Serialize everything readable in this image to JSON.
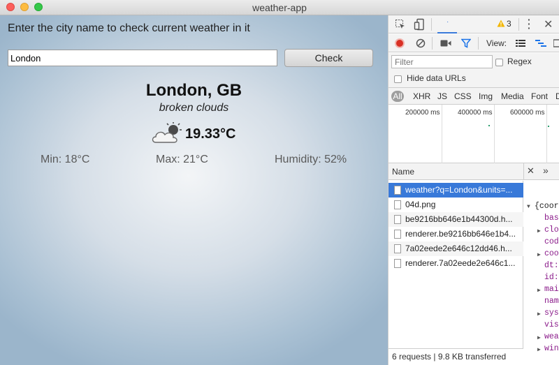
{
  "window": {
    "title": "weather-app"
  },
  "app": {
    "prompt": "Enter the city name to check current weather in it",
    "city_input_value": "London",
    "check_label": "Check",
    "city": "London, GB",
    "description": "broken clouds",
    "weather_icon": "cloud-sun-icon",
    "temperature": "19.33°C",
    "min": "Min: 18°C",
    "max": "Max: 21°C",
    "humidity": "Humidity: 52%"
  },
  "devtools": {
    "warning_count": "3",
    "view_label": "View:",
    "filter_placeholder": "Filter",
    "regex_label": "Regex",
    "hide_data_urls_label": "Hide data URLs",
    "types": [
      "All",
      "XHR",
      "JS",
      "CSS",
      "Img",
      "Media",
      "Font",
      "D"
    ],
    "timeline_ticks": [
      "200000 ms",
      "400000 ms",
      "600000 ms"
    ],
    "name_header": "Name",
    "requests": [
      "weather?q=London&units=...",
      "04d.png",
      "be9216bb646e1b44300d.h...",
      "renderer.be9216bb646e1b4...",
      "7a02eede2e646c12dd46.h...",
      "renderer.7a02eede2e646c1..."
    ],
    "json_lines": [
      "{coor",
      "bas",
      "clo",
      "cod",
      "coo",
      "dt:",
      "id:",
      "mai",
      "nam",
      "sys",
      "vis",
      "wea",
      "win"
    ],
    "status": "6 requests | 9.8 KB transferred",
    "colors": {
      "record": "#d93025",
      "selected": "#3879d9",
      "filter": "#1a73e8"
    }
  }
}
